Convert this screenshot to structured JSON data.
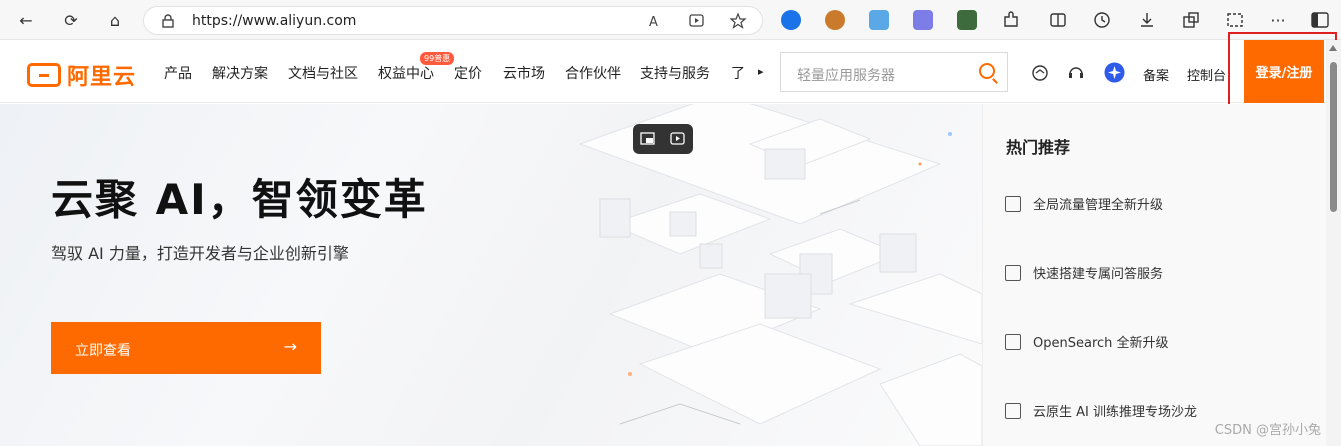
{
  "browser": {
    "url": "https://www.aliyun.com",
    "back_icon": "←",
    "reload_icon": "⟳",
    "home_icon": "⌂",
    "more_icon": "···"
  },
  "nav": {
    "logo_text": "阿里云",
    "items": [
      "产品",
      "解决方案",
      "文档与社区",
      "权益中心",
      "定价",
      "云市场",
      "合作伙伴",
      "支持与服务",
      "了"
    ],
    "badge": "99普惠",
    "more_arrow": "▸",
    "search_placeholder": "轻量应用服务器",
    "beian": "备案",
    "console": "控制台",
    "login": "登录/注册"
  },
  "hero": {
    "title": "云聚 AI，智领变革",
    "subtitle": "驾驭 AI 力量，打造开发者与企业创新引擎",
    "cta_label": "立即查看",
    "cta_arrow": "→"
  },
  "side": {
    "title": "热门推荐",
    "items": [
      "全局流量管理全新升级",
      "快速搭建专属问答服务",
      "OpenSearch 全新升级",
      "云原生 AI 训练推理专场沙龙"
    ]
  },
  "watermark": "CSDN @宫孙小兔",
  "colors": {
    "accent": "#ff6a00",
    "highlight_border": "#e02020"
  }
}
